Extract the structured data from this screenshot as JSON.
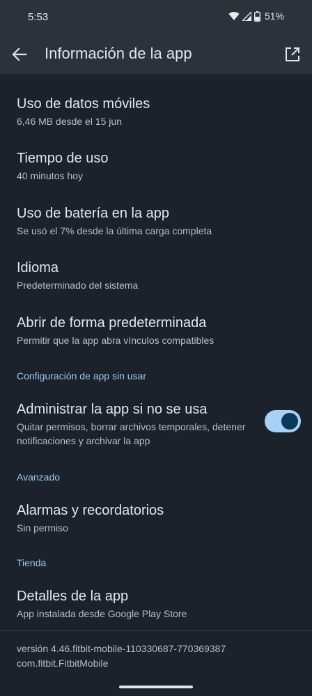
{
  "status_bar": {
    "time": "5:53",
    "battery": "51%",
    "icons": [
      "wifi-icon",
      "signal-icon",
      "battery-icon"
    ]
  },
  "app_bar": {
    "title": "Información de la app",
    "back_icon": "arrow-back-icon",
    "open_icon": "open-in-new-icon"
  },
  "items": [
    {
      "title": "Uso de datos móviles",
      "subtitle": "6,46 MB desde el 15 jun"
    },
    {
      "title": "Tiempo de uso",
      "subtitle": "40 minutos hoy"
    },
    {
      "title": "Uso de batería en la app",
      "subtitle": "Se usó el 7% desde la última carga completa"
    },
    {
      "title": "Idioma",
      "subtitle": "Predeterminado del sistema"
    },
    {
      "title": "Abrir de forma predeterminada",
      "subtitle": "Permitir que la app abra vínculos compatibles"
    }
  ],
  "sections": {
    "unused": {
      "header": "Configuración de app sin usar",
      "item": {
        "title": "Administrar la app si no se usa",
        "subtitle": "Quitar permisos, borrar archivos temporales, detener notificaciones y archivar la app",
        "toggle_on": true
      }
    },
    "advanced": {
      "header": "Avanzado",
      "item": {
        "title": "Alarmas y recordatorios",
        "subtitle": "Sin permiso"
      }
    },
    "store": {
      "header": "Tienda",
      "item": {
        "title": "Detalles de la app",
        "subtitle": "App instalada desde Google Play Store"
      }
    }
  },
  "footer": {
    "version": "versión 4.46.fitbit-mobile-110330687-770369387",
    "package": "com.fitbit.FitbitMobile"
  },
  "colors": {
    "background": "#1b222b",
    "app_bar": "#2b323a",
    "accent": "#9fc8ee",
    "toggle_track": "#a9d0f5",
    "toggle_thumb": "#0c3a5a"
  }
}
